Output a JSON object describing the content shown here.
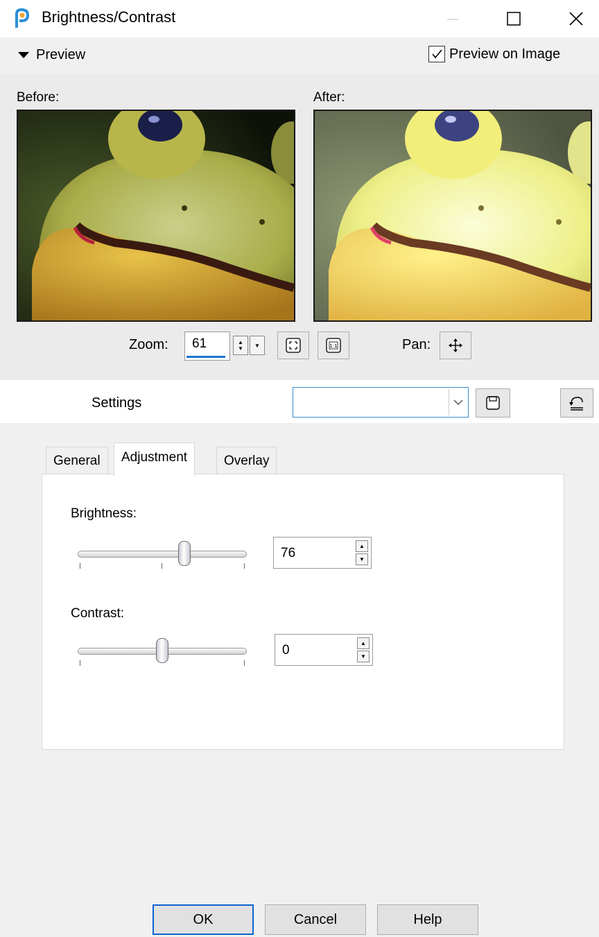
{
  "window": {
    "title": "Brightness/Contrast",
    "app_icon": "paintshop-pro-icon",
    "controls": [
      "minimize-icon",
      "maximize-icon",
      "close-icon"
    ]
  },
  "preview": {
    "toggle_label": "Preview",
    "preview_on_image_label": "Preview on Image",
    "preview_on_image_checked": true,
    "before_label": "Before:",
    "after_label": "After:"
  },
  "zoom": {
    "label": "Zoom:",
    "value": "61"
  },
  "pan": {
    "label": "Pan:"
  },
  "settings": {
    "label": "Settings",
    "selected": ""
  },
  "tabs": [
    {
      "label": "General",
      "active": false
    },
    {
      "label": "Adjustment",
      "active": true
    },
    {
      "label": "Overlay",
      "active": false
    }
  ],
  "adjustment": {
    "brightness_label": "Brightness:",
    "brightness_value": "76",
    "contrast_label": "Contrast:",
    "contrast_value": "0"
  },
  "buttons": {
    "ok": "OK",
    "cancel": "Cancel",
    "help": "Help"
  },
  "colors": {
    "accent": "#0a64d0",
    "zoom_underline": "#1874d1"
  }
}
